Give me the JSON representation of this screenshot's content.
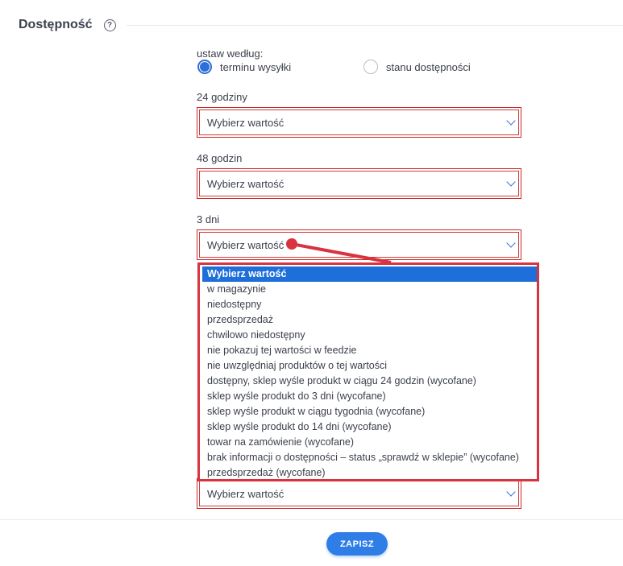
{
  "section": {
    "title": "Dostępność",
    "help_icon": "?"
  },
  "mode": {
    "label": "ustaw według:",
    "options": [
      {
        "label": "terminu wysyłki",
        "checked": true
      },
      {
        "label": "stanu dostępności",
        "checked": false
      }
    ]
  },
  "fields": [
    {
      "label": "24 godziny",
      "value": "Wybierz wartość"
    },
    {
      "label": "48 godzin",
      "value": "Wybierz wartość"
    },
    {
      "label": "3 dni",
      "value": "Wybierz wartość"
    },
    {
      "label": "",
      "value": "Wybierz wartość"
    }
  ],
  "dropdown": {
    "options": [
      "Wybierz wartość",
      "w magazynie",
      "niedostępny",
      "przedsprzedaż",
      "chwilowo niedostępny",
      "nie pokazuj tej wartości w feedzie",
      "nie uwzględniaj produktów o tej wartości",
      "dostępny, sklep wyśle produkt w ciągu 24 godzin (wycofane)",
      "sklep wyśle produkt do 3 dni (wycofane)",
      "sklep wyśle produkt w ciągu tygodnia (wycofane)",
      "sklep wyśle produkt do 14 dni (wycofane)",
      "towar na zamówienie (wycofane)",
      "brak informacji o dostępności – status „sprawdź w sklepie” (wycofane)",
      "przedsprzedaż (wycofane)"
    ],
    "selected_index": 0
  },
  "footer": {
    "save_label": "ZAPISZ"
  },
  "colors": {
    "accent": "#2f7ee8",
    "error_border": "#c62828",
    "annotation": "#d9333f"
  }
}
